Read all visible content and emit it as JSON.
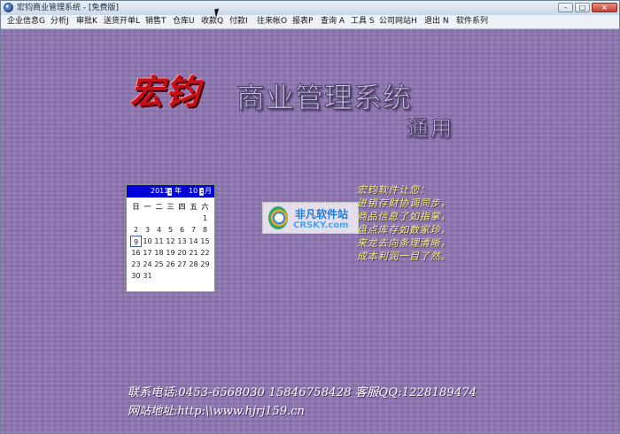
{
  "window": {
    "title": "宏钧商业管理系统 - [免费版]"
  },
  "controls": {
    "minimize": "–",
    "maximize": "□",
    "close": "×"
  },
  "menu": [
    "企业信息G",
    "分析J",
    "审批K",
    "送货开单L",
    "销售T",
    "仓库U",
    "收款Q",
    "付款I",
    "往来帐O",
    "报表P",
    "查询 A",
    "工具 S",
    "公司网站H",
    "退出 N",
    "软件系列"
  ],
  "brand": {
    "red": "宏钧",
    "main": "商业管理系统",
    "sub": "通用"
  },
  "calendar": {
    "year": "2011",
    "year_unit": "年",
    "month": "10",
    "month_unit": "月",
    "weekdays": [
      "日",
      "一",
      "二",
      "三",
      "四",
      "五",
      "六"
    ],
    "rows": [
      [
        "",
        "",
        "",
        "",
        "",
        "",
        "1"
      ],
      [
        "2",
        "3",
        "4",
        "5",
        "6",
        "7",
        "8"
      ],
      [
        "9",
        "10",
        "11",
        "12",
        "13",
        "14",
        "15"
      ],
      [
        "16",
        "17",
        "18",
        "19",
        "20",
        "21",
        "22"
      ],
      [
        "23",
        "24",
        "25",
        "26",
        "27",
        "28",
        "29"
      ],
      [
        "30",
        "31",
        "",
        "",
        "",
        "",
        ""
      ]
    ],
    "selected": "9"
  },
  "watermark": {
    "title": "非凡软件站",
    "site": "CRSKY.com"
  },
  "slogan": [
    "宏钧软件让您：",
    "进销存财协调同步，",
    "商品信息了如指掌，",
    "盘点库存如数家珍，",
    "来龙去向条理清晰，",
    "成本利润一目了然。"
  ],
  "contact": {
    "line1": "联系电话:0453-6568030  15846758428  客服QQ:1228189474",
    "line2": "网站地址:http:\\\\www.hjrj159.cn"
  },
  "colors": {
    "workspace": "#8f77b3",
    "calendar_header": "#0000d8",
    "slogan": "#f5ef77"
  }
}
